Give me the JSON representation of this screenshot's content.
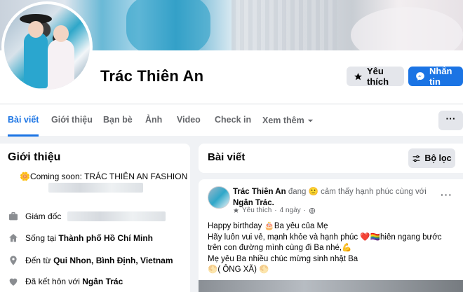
{
  "profile": {
    "name": "Trác Thiên An",
    "like_label": "Yêu thích",
    "message_label": "Nhắn tin"
  },
  "tabs": [
    {
      "label": "Bài viết",
      "active": true
    },
    {
      "label": "Giới thiệu"
    },
    {
      "label": "Bạn bè"
    },
    {
      "label": "Ảnh"
    },
    {
      "label": "Video"
    },
    {
      "label": "Check in"
    },
    {
      "label": "Xem thêm"
    }
  ],
  "more_button": "···",
  "intro": {
    "title": "Giới thiệu",
    "bio_line": "🌼Coming soon: TRÁC THIÊN AN FASHION",
    "rows": [
      {
        "icon": "briefcase-icon",
        "prefix": "Giám đốc",
        "value": ""
      },
      {
        "icon": "home-icon",
        "prefix": "Sống tại ",
        "value": "Thành phố Hồ Chí Minh"
      },
      {
        "icon": "location-pin-icon",
        "prefix": "Đến từ ",
        "value": "Qui Nhon, Bình Định, Vietnam"
      },
      {
        "icon": "heart-icon",
        "prefix": "Đã kết hôn với ",
        "value": "Ngân Trác"
      }
    ]
  },
  "posts": {
    "title": "Bài viết",
    "filter_label": "Bộ lọc"
  },
  "post": {
    "author": "Trác Thiên An",
    "feeling_text": " đang 🙂 cảm thấy hạnh phúc cùng với ",
    "tagged": "Ngân Trác.",
    "audience": "Yêu thích",
    "time": "4 ngày",
    "separator": "·",
    "dots": "···",
    "lines": [
      "Happy birthday 🎂Ba yêu của Mẹ",
      "Hãy luôn vui vẻ, mạnh  khỏe và hạnh phúc ❤️🏳️‍🌈hiên ngang bước trên con đường mình cùng đi Ba nhé,💪",
      "Mẹ yêu Ba nhiều chúc mừng sinh nhật Ba",
      "🌕( ÔNG XÃ) 🌕"
    ]
  },
  "colors": {
    "accent": "#1b74e4",
    "secondary_button": "#e4e6eb",
    "background": "#f0f2f5",
    "muted_text": "#65676b"
  }
}
